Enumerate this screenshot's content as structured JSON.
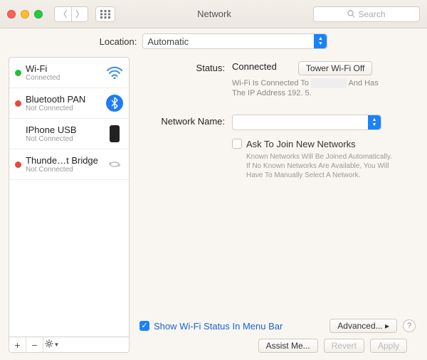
{
  "window": {
    "title": "Network",
    "search_placeholder": "Search"
  },
  "location": {
    "label": "Location:",
    "value": "Automatic"
  },
  "services": [
    {
      "name": "Wi-Fi",
      "status": "Connected",
      "dot": "green-dot",
      "icon": "wifi"
    },
    {
      "name": "Bluetooth PAN",
      "status": "Not Connected",
      "dot": "red-dot",
      "icon": "bt"
    },
    {
      "name": "IPhone USB",
      "status": "Not Connected",
      "dot": "",
      "icon": "phone"
    },
    {
      "name": "Thunde…t Bridge",
      "status": "Not Connected",
      "dot": "red-dot",
      "icon": "thunder"
    }
  ],
  "list_toolbar": {
    "add": "+",
    "remove": "−",
    "gear": "✱▾"
  },
  "detail": {
    "status_label": "Status:",
    "status_value": "Connected",
    "toggle_button": "Tower Wi-Fi Off",
    "status_hint_line1": "Wi-Fi Is Connected To ",
    "status_hint_line1b": " And Has",
    "status_hint_line2": "The IP Address 192.           5.",
    "netname_label": "Network Name:",
    "netname_value": "",
    "ask_label": "Ask To Join New Networks",
    "ask_hint": "Known Networks Will Be Joined Automatically. If No Known Networks Are Available, You Will Have To Manually Select A Network.",
    "show_menubar": "Show Wi-Fi Status In Menu Bar",
    "advanced": "Advanced... ▸"
  },
  "footer": {
    "assist": "Assist Me...",
    "revert": "Revert",
    "apply": "Apply"
  }
}
